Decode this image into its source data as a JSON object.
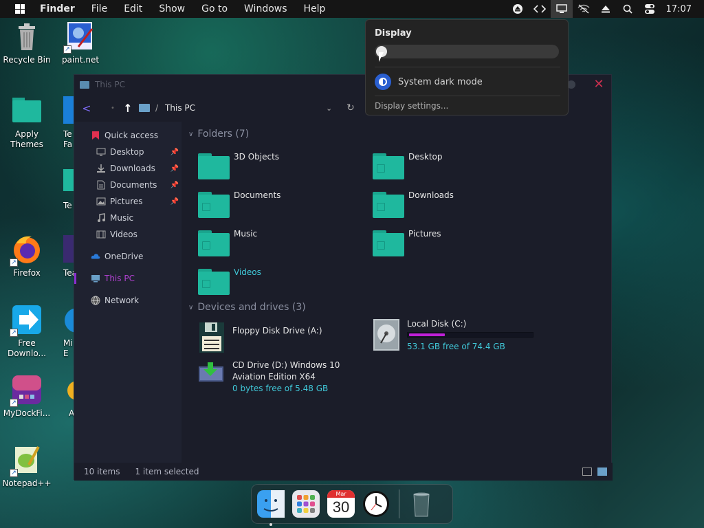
{
  "menubar": {
    "app_name": "Finder",
    "items": [
      "File",
      "Edit",
      "Show",
      "Go to",
      "Windows",
      "Help"
    ],
    "clock": "17:07"
  },
  "desktop_icons": [
    {
      "label": "Recycle Bin"
    },
    {
      "label": "paint.net"
    },
    {
      "label": "Apply Themes"
    },
    {
      "label": "Te Fa"
    },
    {
      "label": "Te"
    },
    {
      "label": "Firefox"
    },
    {
      "label": "Tear"
    },
    {
      "label": "Free Downlo..."
    },
    {
      "label": "Mi E"
    },
    {
      "label": "MyDockFi..."
    },
    {
      "label": "A"
    },
    {
      "label": "Notepad++"
    }
  ],
  "explorer": {
    "title": "This PC",
    "breadcrumb_sep": "/",
    "breadcrumb": "This PC",
    "sidebar": {
      "quick_access": "Quick access",
      "items": [
        {
          "label": "Desktop",
          "pinned": true
        },
        {
          "label": "Downloads",
          "pinned": true
        },
        {
          "label": "Documents",
          "pinned": true
        },
        {
          "label": "Pictures",
          "pinned": true
        },
        {
          "label": "Music",
          "pinned": false
        },
        {
          "label": "Videos",
          "pinned": false
        }
      ],
      "onedrive": "OneDrive",
      "this_pc": "This PC",
      "network": "Network"
    },
    "folders_header": "Folders (7)",
    "folders": [
      "3D Objects",
      "Desktop",
      "Documents",
      "Downloads",
      "Music",
      "Pictures",
      "Videos"
    ],
    "drives_header": "Devices and drives (3)",
    "drives": {
      "floppy": {
        "name": "Floppy Disk Drive (A:)"
      },
      "local": {
        "name": "Local Disk (C:)",
        "free": "53.1 GB free of 74.4 GB",
        "used_fraction": 0.29
      },
      "cd": {
        "name_line1": "CD Drive (D:) Windows 10",
        "name_line2": "Aviation Edition X64",
        "free": "0 bytes free of 5.48 GB"
      }
    },
    "status": {
      "items": "10 items",
      "selected": "1 item selected"
    }
  },
  "display_popup": {
    "title": "Display",
    "brightness_fraction": 0.0,
    "dark_mode_label": "System dark mode",
    "settings_link": "Display settings..."
  },
  "dock": {
    "calendar_month": "Mar",
    "calendar_day": "30"
  },
  "colors": {
    "accent_purple": "#8a2ed0",
    "folder_teal": "#1fb89e",
    "link_cyan": "#40c8d8",
    "disk_bar": "#c020d8"
  }
}
